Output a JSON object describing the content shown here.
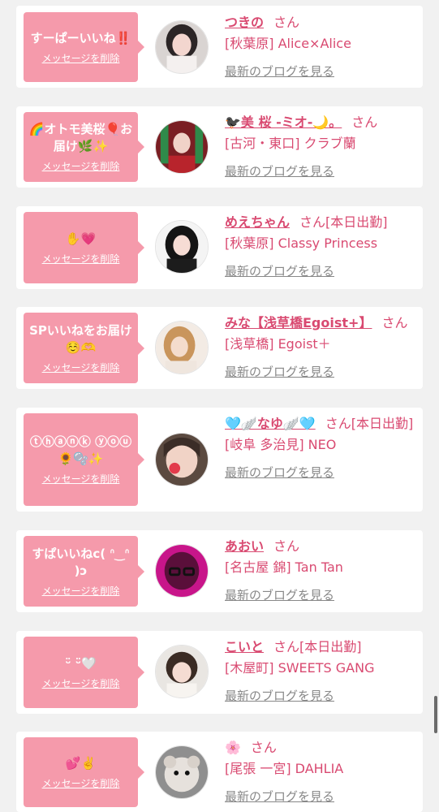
{
  "delete_label": "メッセージを削除",
  "blog_label": "最新のブログを見る",
  "san": "さん",
  "colors": {
    "bubble": "#f59aab",
    "accent": "#d94a71",
    "link_gray": "#888888"
  },
  "cards": [
    {
      "message": "すーぱーいいね‼️",
      "name": "つきの",
      "suffix": "",
      "shop": "[秋葉原] Alice×Alice"
    },
    {
      "message": "🌈オトモ美桜🎈お届け🌿✨",
      "name": "🐦‍⬛美 桜 -ミオ-🌙。",
      "suffix": "",
      "shop": "[古河・東口] クラブ蘭"
    },
    {
      "message": "✋💗",
      "name": "めえちゃん",
      "suffix": "[本日出勤]",
      "shop": "[秋葉原] Classy Princess"
    },
    {
      "message": "SPいいねをお届け☺️🫶",
      "name": "みな【浅草橋Egoist+】",
      "suffix": "",
      "shop": "[浅草橋] Egoist＋"
    },
    {
      "message": "ⓣⓗⓐⓝⓚ ⓨⓞⓤ🌻🫧✨",
      "name": "🩵🪽なゆ🪽🩵",
      "suffix": "[本日出勤]",
      "shop": "[岐阜 多治見] NEO"
    },
    {
      "message": "すぱいいねc( ᐢ‿ᐢ )ɔ",
      "name": "あおい",
      "suffix": "",
      "shop": "[名古屋 錦] Tan Tan"
    },
    {
      "message": "ᵕ̈ ᵕ̈🤍",
      "name": "こいと",
      "suffix": "[本日出勤]",
      "shop": "[木屋町] SWEETS GANG"
    },
    {
      "message": "💕✌️",
      "name": "🌸",
      "suffix": "",
      "shop": "[尾張 一宮] DAHLIA"
    }
  ]
}
